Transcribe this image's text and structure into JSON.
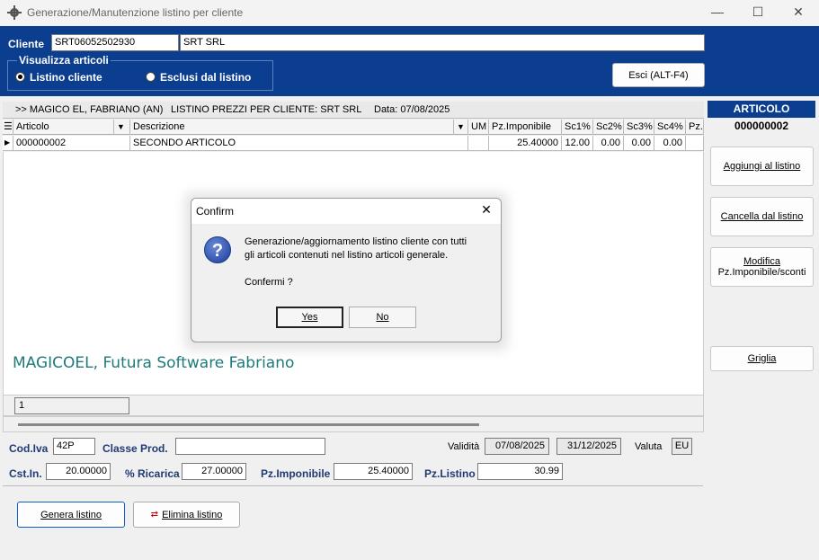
{
  "window": {
    "title": "Generazione/Manutenzione listino per cliente",
    "minimize": "—",
    "maximize": "☐",
    "close": "✕"
  },
  "header": {
    "cliente_label": "Cliente",
    "cliente_code": "SRT06052502930",
    "cliente_name": "SRT SRL",
    "visualizza_label": "Visualizza articoli",
    "radio_listino": "Listino cliente",
    "radio_esclusi": "Esclusi dal listino",
    "selected_radio": "Listino cliente",
    "esci_button": "Esci (ALT-F4)"
  },
  "grid": {
    "top_company": ">> MAGICO EL, FABRIANO (AN)",
    "top_listino": "LISTINO PREZZI PER CLIENTE: SRT SRL",
    "top_data": "Data: 07/08/2025",
    "columns": [
      "Articolo",
      "Descrizione",
      "UM",
      "Pz.Imponibile",
      "Sc1%",
      "Sc2%",
      "Sc3%",
      "Sc4%",
      "Pz."
    ],
    "rows": [
      {
        "articolo": "000000002",
        "descrizione": "SECONDO ARTICOLO",
        "um": "",
        "pz_imponibile": "25.40000",
        "sc1": "12.00",
        "sc2": "0.00",
        "sc3": "0.00",
        "sc4": "0.00",
        "pz": ""
      }
    ],
    "watermark": "MAGICOEL, Futura Software Fabriano",
    "record_counter": "1"
  },
  "right_panel": {
    "header": "ARTICOLO",
    "code": "000000002",
    "btn_aggiungi": "Aggiungi al listino",
    "btn_cancella": "Cancella dal listino",
    "btn_modifica_1": "Modifica",
    "btn_modifica_2": "Pz.Imponibile/sconti",
    "btn_griglia": "Griglia"
  },
  "form": {
    "cod_iva_label": "Cod.Iva",
    "cod_iva": "42P",
    "classe_prod_label": "Classe Prod.",
    "classe_prod": "",
    "validita_label": "Validità",
    "validita_da": "07/08/2025",
    "validita_a": "31/12/2025",
    "valuta_label": "Valuta",
    "valuta": "EU",
    "cst_in_label": "Cst.In.",
    "cst_in": "20.00000",
    "ricarica_label": "% Ricarica",
    "ricarica": "27.00000",
    "pz_imponibile_label": "Pz.Imponibile",
    "pz_imponibile": "25.40000",
    "pz_listino_label": "Pz.Listino",
    "pz_listino": "30.99"
  },
  "bottom_buttons": {
    "genera": "Genera listino",
    "elimina": "Elimina listino"
  },
  "dialog": {
    "title": "Confirm",
    "message_line1": "Generazione/aggiornamento listino cliente con tutti",
    "message_line2": "gli articoli contenuti nel listino articoli generale.",
    "question": "Confermi ?",
    "yes": "Yes",
    "no": "No",
    "close": "✕"
  },
  "colors": {
    "header_blue": "#0b3e8f",
    "watermark_teal": "#1f7a7a",
    "form_label_blue": "#1f3a74"
  }
}
